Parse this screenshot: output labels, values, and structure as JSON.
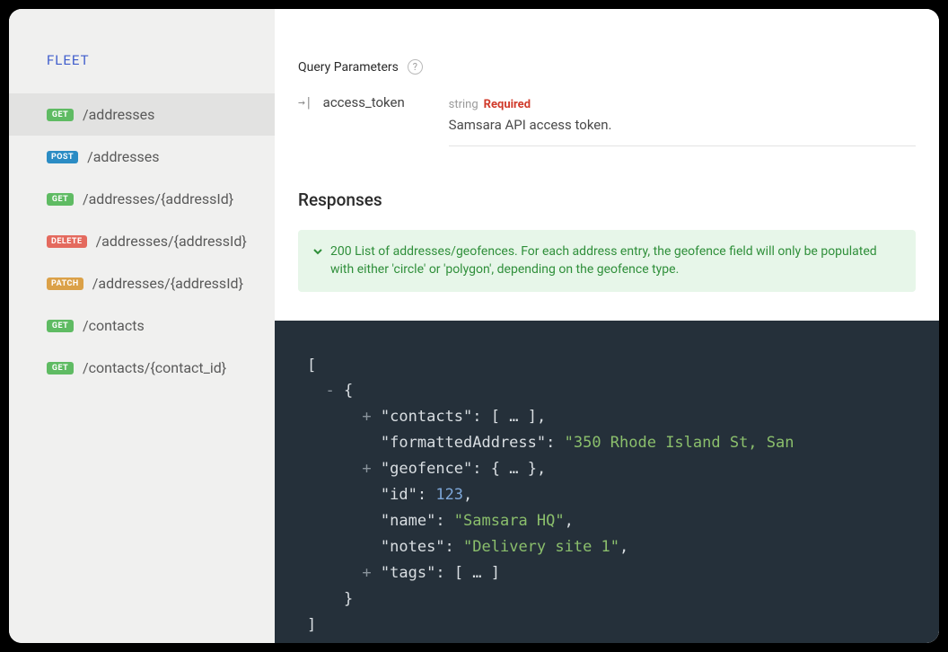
{
  "sidebar": {
    "title": "FLEET",
    "items": [
      {
        "method": "GET",
        "path": "/addresses",
        "active": true
      },
      {
        "method": "POST",
        "path": "/addresses",
        "active": false
      },
      {
        "method": "GET",
        "path": "/addresses/{addressId}",
        "active": false
      },
      {
        "method": "DELETE",
        "path": "/addresses/{addressId}",
        "active": false
      },
      {
        "method": "PATCH",
        "path": "/addresses/{addressId}",
        "active": false
      },
      {
        "method": "GET",
        "path": "/contacts",
        "active": false
      },
      {
        "method": "GET",
        "path": "/contacts/{contact_id}",
        "active": false
      }
    ]
  },
  "query_params": {
    "section_label": "Query Parameters",
    "items": [
      {
        "name": "access_token",
        "type": "string",
        "required_label": "Required",
        "description": "Samsara API access token."
      }
    ]
  },
  "responses": {
    "title": "Responses",
    "banner": "200 List of addresses/geofences. For each address entry, the geofence field will only be populated with either 'circle' or 'polygon', depending on the geofence type."
  },
  "code": {
    "contacts_key": "\"contacts\"",
    "contacts_val": "[ … ]",
    "formatted_key": "\"formattedAddress\"",
    "formatted_val": "\"350 Rhode Island St, San",
    "geofence_key": "\"geofence\"",
    "geofence_val": "{ … }",
    "id_key": "\"id\"",
    "id_val": "123",
    "name_key": "\"name\"",
    "name_val": "\"Samsara HQ\"",
    "notes_key": "\"notes\"",
    "notes_val": "\"Delivery site 1\"",
    "tags_key": "\"tags\"",
    "tags_val": "[ … ]"
  }
}
